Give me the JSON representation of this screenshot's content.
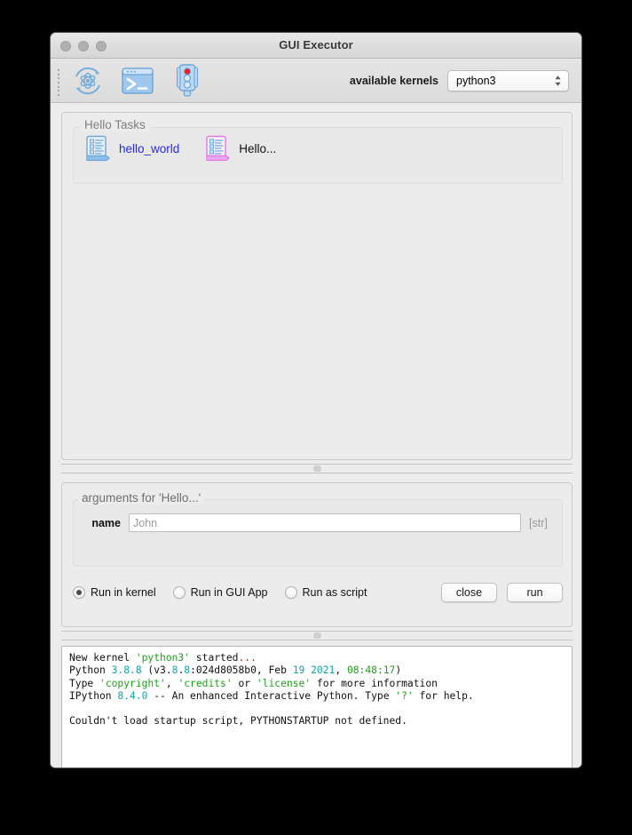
{
  "window": {
    "title": "GUI Executor",
    "traffic_lights": [
      "close",
      "minimize",
      "zoom"
    ]
  },
  "toolbar": {
    "icons": [
      {
        "name": "kernel-restart-icon",
        "label": "restart kernel"
      },
      {
        "name": "terminal-icon",
        "label": "console"
      },
      {
        "name": "traffic-light-icon",
        "label": "kernel status"
      }
    ],
    "kernels_label": "available kernels",
    "kernel_selected": "python3",
    "kernel_options": [
      "python3"
    ]
  },
  "tasks": {
    "group_title": "Hello Tasks",
    "items": [
      {
        "name": "task-hello-world",
        "label": "hello_world",
        "icon": "script-document-blue-icon",
        "style": "link"
      },
      {
        "name": "task-hello-ellipsis",
        "label": "Hello...",
        "icon": "script-document-pink-icon",
        "style": "plain"
      }
    ]
  },
  "arguments": {
    "title": "arguments for 'Hello...'",
    "fields": [
      {
        "name": "name",
        "label": "name",
        "value": "",
        "placeholder": "John",
        "type_hint": "[str]"
      }
    ],
    "run_modes": [
      {
        "id": "run-in-kernel",
        "label": "Run in kernel",
        "selected": true
      },
      {
        "id": "run-in-gui-app",
        "label": "Run in GUI App",
        "selected": false
      },
      {
        "id": "run-as-script",
        "label": "Run as script",
        "selected": false
      }
    ],
    "buttons": [
      {
        "id": "close",
        "label": "close"
      },
      {
        "id": "run",
        "label": "run"
      }
    ]
  },
  "console": {
    "lines": [
      [
        {
          "t": "New kernel ",
          "c": "plain"
        },
        {
          "t": "'python3'",
          "c": "green"
        },
        {
          "t": " started",
          "c": "plain"
        },
        {
          "t": "...",
          "c": "red"
        }
      ],
      [
        {
          "t": "Python ",
          "c": "plain"
        },
        {
          "t": "3.8.8",
          "c": "teal"
        },
        {
          "t": " (v3.",
          "c": "plain"
        },
        {
          "t": "8",
          "c": "teal"
        },
        {
          "t": ".",
          "c": "plain"
        },
        {
          "t": "8",
          "c": "teal"
        },
        {
          "t": ":024d8058b0, Feb ",
          "c": "plain"
        },
        {
          "t": "19",
          "c": "teal"
        },
        {
          "t": " ",
          "c": "plain"
        },
        {
          "t": "2021",
          "c": "teal"
        },
        {
          "t": ", ",
          "c": "plain"
        },
        {
          "t": "08:48:17",
          "c": "green"
        },
        {
          "t": ")",
          "c": "plain"
        }
      ],
      [
        {
          "t": "Type ",
          "c": "plain"
        },
        {
          "t": "'copyright'",
          "c": "green"
        },
        {
          "t": ", ",
          "c": "plain"
        },
        {
          "t": "'credits'",
          "c": "green"
        },
        {
          "t": " or ",
          "c": "plain"
        },
        {
          "t": "'license'",
          "c": "green"
        },
        {
          "t": " for more information",
          "c": "plain"
        }
      ],
      [
        {
          "t": "IPython ",
          "c": "plain"
        },
        {
          "t": "8.4.0",
          "c": "teal"
        },
        {
          "t": " -- An enhanced Interactive Python. Type ",
          "c": "plain"
        },
        {
          "t": "'?'",
          "c": "green"
        },
        {
          "t": " for help.",
          "c": "plain"
        }
      ],
      [
        {
          "t": "",
          "c": "plain"
        }
      ],
      [
        {
          "t": "Couldn't load startup script, PYTHONSTARTUP not defined.",
          "c": "plain"
        }
      ]
    ]
  },
  "colors": {
    "link_blue": "#2b2bdd",
    "icon_blue": "#5b9bd5",
    "icon_pink": "#e060e0",
    "console_green": "#20a020",
    "console_teal": "#12a5a5",
    "console_red": "#b02020",
    "window_bg": "#ececec"
  }
}
